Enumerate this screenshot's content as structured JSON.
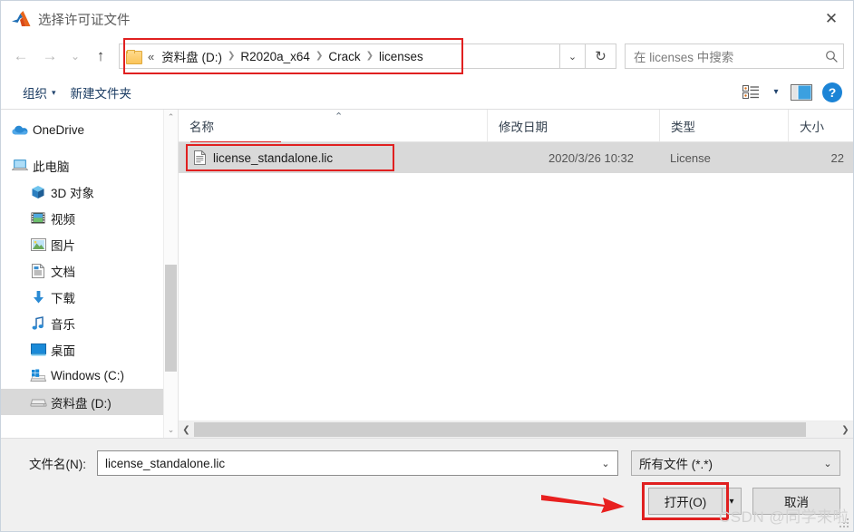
{
  "window": {
    "title": "选择许可证文件",
    "app_icon": "matlab-logo-icon",
    "close_label": "✕"
  },
  "navigation": {
    "back_icon": "←",
    "forward_icon": "→",
    "recent_icon": "⌄",
    "up_icon": "↑",
    "breadcrumb": {
      "overflow": "«",
      "segments": [
        "资料盘 (D:)",
        "R2020a_x64",
        "Crack",
        "licenses"
      ],
      "separator": "❯",
      "dropdown_icon": "⌄"
    },
    "refresh_icon": "↻",
    "search": {
      "placeholder": "在 licenses 中搜索",
      "icon": "search-icon"
    }
  },
  "toolbar": {
    "organize_label": "组织",
    "organize_caret": "▾",
    "new_folder_label": "新建文件夹",
    "view_icon": "view-list-icon",
    "view_caret": "▾",
    "preview_icon": "preview-pane-icon",
    "help_label": "?"
  },
  "sidebar": {
    "items": [
      {
        "label": "OneDrive",
        "icon": "onedrive-cloud-icon",
        "indent": false,
        "selected": false
      },
      {
        "label": "此电脑",
        "icon": "this-pc-icon",
        "indent": false,
        "selected": false
      },
      {
        "label": "3D 对象",
        "icon": "3d-objects-icon",
        "indent": true,
        "selected": false
      },
      {
        "label": "视频",
        "icon": "videos-icon",
        "indent": true,
        "selected": false
      },
      {
        "label": "图片",
        "icon": "pictures-icon",
        "indent": true,
        "selected": false
      },
      {
        "label": "文档",
        "icon": "documents-icon",
        "indent": true,
        "selected": false
      },
      {
        "label": "下载",
        "icon": "downloads-icon",
        "indent": true,
        "selected": false
      },
      {
        "label": "音乐",
        "icon": "music-icon",
        "indent": true,
        "selected": false
      },
      {
        "label": "桌面",
        "icon": "desktop-icon",
        "indent": true,
        "selected": false
      },
      {
        "label": "Windows (C:)",
        "icon": "windows-drive-icon",
        "indent": true,
        "selected": false
      },
      {
        "label": "资料盘 (D:)",
        "icon": "hard-drive-icon",
        "indent": true,
        "selected": true
      }
    ],
    "scroll_up_icon": "⌃",
    "scroll_down_icon": "⌄"
  },
  "filelist": {
    "columns": [
      "名称",
      "修改日期",
      "类型",
      "大小"
    ],
    "sort_caret": "⌃",
    "rows": [
      {
        "name": "license_standalone.lic",
        "modified": "2020/3/26 10:32",
        "type": "License",
        "size": "22",
        "icon": "license-file-icon",
        "selected": true,
        "highlighted": true
      }
    ],
    "hscroll_left_icon": "❮",
    "hscroll_right_icon": "❯"
  },
  "footer": {
    "filename_label": "文件名(N):",
    "filename_value": "license_standalone.lic",
    "filename_caret": "⌄",
    "filetype_value": "所有文件 (*.*)",
    "filetype_caret": "⌄",
    "open_label": "打开(O)",
    "open_caret": "▾",
    "cancel_label": "取消"
  },
  "annotations": {
    "watermark": "CSDN @同学来啦",
    "highlight_color": "#e02020",
    "arrow_color": "#e8201f"
  }
}
